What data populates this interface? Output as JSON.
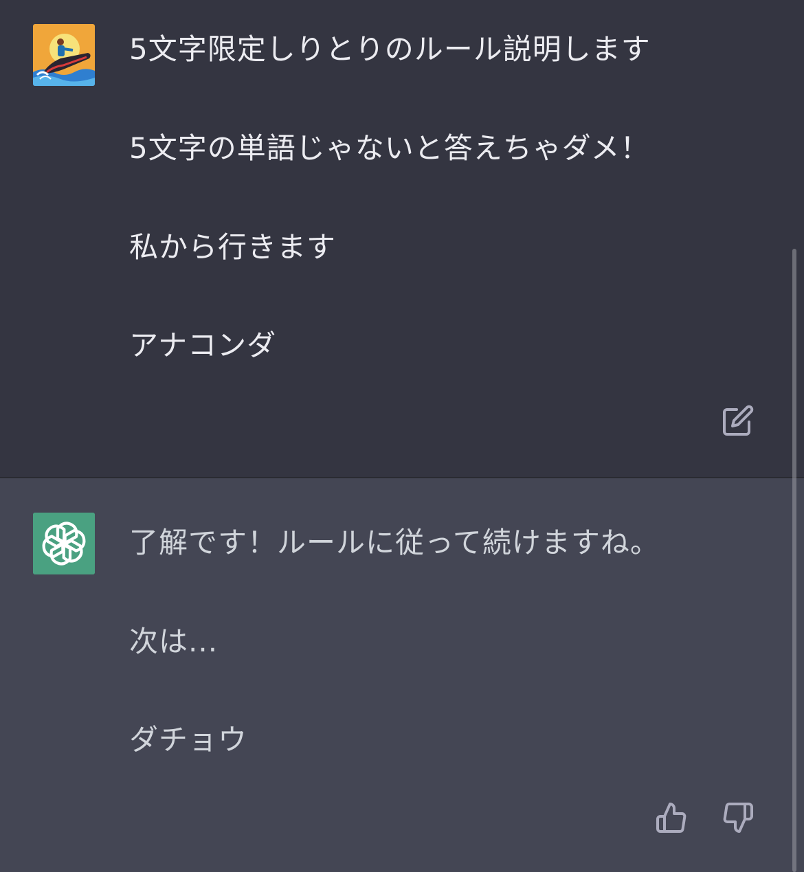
{
  "user_message": {
    "avatar_icon": "jetski-rider-avatar-icon",
    "lines": [
      "5文字限定しりとりのルール説明します",
      "5文字の単語じゃないと答えちゃダメ！",
      "私から行きます",
      "アナコンダ"
    ],
    "edit_icon": "edit-icon"
  },
  "assistant_message": {
    "avatar_icon": "openai-logo-icon",
    "lines": [
      "了解です！ルールに従って続けますね。",
      "次は...",
      "ダチョウ"
    ],
    "thumbs_up_icon": "thumbs-up-icon",
    "thumbs_down_icon": "thumbs-down-icon"
  },
  "colors": {
    "user_bg": "#343541",
    "assistant_bg": "#444654",
    "assistant_avatar_bg": "#4aa181",
    "text_primary": "#ececf1",
    "text_secondary": "#d1d5db",
    "icon_color": "#acacbe"
  }
}
